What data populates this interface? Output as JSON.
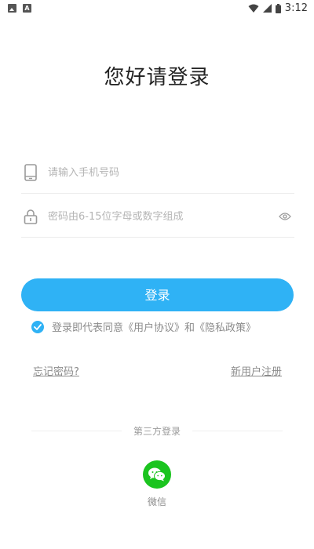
{
  "status_bar": {
    "time": "3:12"
  },
  "title": "您好请登录",
  "phone_field": {
    "placeholder": "请输入手机号码",
    "icon": "phone-icon"
  },
  "password_field": {
    "placeholder": "密码由6-15位字母或数字组成",
    "icon": "lock-icon",
    "toggle_icon": "eye-icon"
  },
  "login_button": {
    "label": "登录"
  },
  "agreement": {
    "checked": true,
    "text": "登录即代表同意《用户协议》和《隐私政策》"
  },
  "links": {
    "forgot": "忘记密码?",
    "register": "新用户注册"
  },
  "third_party": {
    "label": "第三方登录",
    "wechat_label": "微信"
  },
  "colors": {
    "accent": "#2fb2f5",
    "wechat": "#1bc41f"
  }
}
